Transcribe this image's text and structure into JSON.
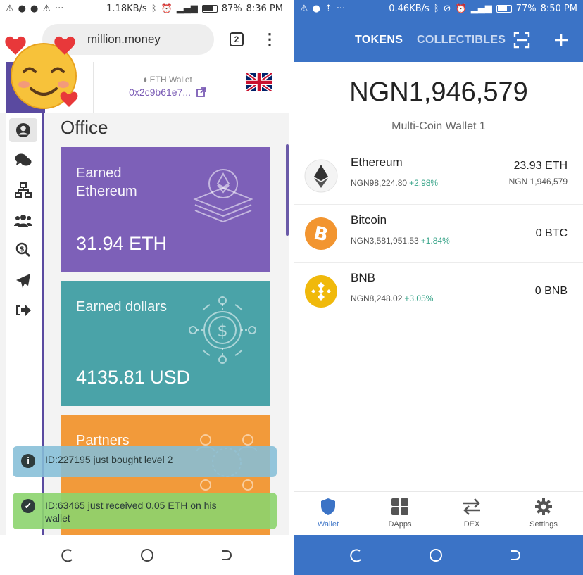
{
  "left_status": {
    "speed": "1.18KB/s",
    "battery": "87%",
    "time": "8:36 PM",
    "battery_level": 0.87
  },
  "browser": {
    "url": "million.money",
    "tab_count": "2"
  },
  "site_header": {
    "wallet_label": "ETH Wallet",
    "wallet_address": "0x2c9b61e7..."
  },
  "office": {
    "title": "Office",
    "cards": [
      {
        "title": "Earned Ethereum",
        "value": "31.94 ETH",
        "color": "#7d60b8"
      },
      {
        "title": "Earned dollars",
        "value": "4135.81 USD",
        "color": "#4aa3a8"
      },
      {
        "title": "Partners",
        "color": "#f29a3a"
      }
    ]
  },
  "toasts": [
    {
      "icon": "info-icon",
      "text": "ID:227195 just bought level 2",
      "color": "#85bed7"
    },
    {
      "icon": "check-circle-icon",
      "text": "ID:63465 just received 0.05 ETH on his wallet",
      "color": "#8cd46e"
    }
  ],
  "right_status": {
    "speed": "0.46KB/s",
    "battery": "77%",
    "time": "8:50 PM",
    "battery_level": 0.77
  },
  "wallet": {
    "tabs": [
      "TOKENS",
      "COLLECTIBLES"
    ],
    "balance": "NGN1,946,579",
    "wallet_name": "Multi-Coin Wallet 1",
    "accent": "#3b73c6",
    "tokens": [
      {
        "name": "Ethereum",
        "price": "NGN98,224.80",
        "change": "+2.98%",
        "amount": "23.93 ETH",
        "fiat": "NGN 1,946,579",
        "icon": "ethereum-icon"
      },
      {
        "name": "Bitcoin",
        "price": "NGN3,581,951.53",
        "change": "+1.84%",
        "amount": "0 BTC",
        "icon": "bitcoin-icon"
      },
      {
        "name": "BNB",
        "price": "NGN8,248.02",
        "change": "+3.05%",
        "amount": "0 BNB",
        "icon": "bnb-icon"
      }
    ],
    "tabbar": [
      {
        "label": "Wallet",
        "icon": "shield-icon"
      },
      {
        "label": "DApps",
        "icon": "grid-icon"
      },
      {
        "label": "DEX",
        "icon": "swap-arrows-icon"
      },
      {
        "label": "Settings",
        "icon": "gear-icon"
      }
    ]
  }
}
